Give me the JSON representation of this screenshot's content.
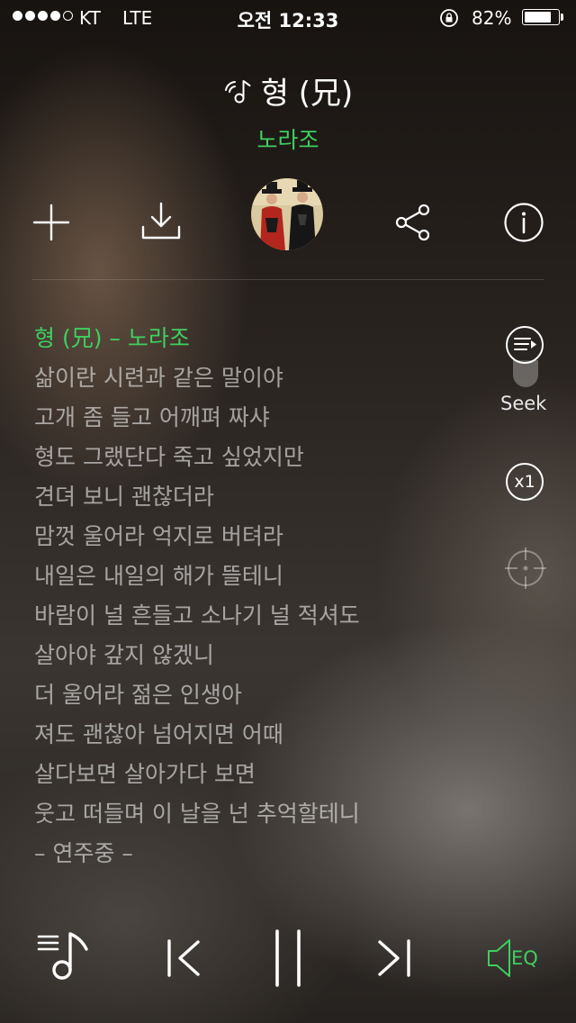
{
  "status_bar": {
    "carrier": "KT",
    "network": "LTE",
    "time": "오전 12:33",
    "battery_percent": "82%",
    "battery_level": 0.82
  },
  "song": {
    "title": "형 (兄)",
    "artist": "노라조"
  },
  "lyrics": {
    "current_line": "형 (兄) – 노라조",
    "lines": [
      "삶이란 시련과 같은 말이야",
      "고개 좀 들고 어깨펴 짜샤",
      "형도 그랬단다 죽고 싶었지만",
      "견뎌 보니 괜찮더라",
      "맘껏 울어라 억지로 버텨라",
      "내일은 내일의 해가 뜰테니",
      "바람이 널 흔들고 소나기 널 적셔도",
      "살아야 갚지 않겠니",
      "더 울어라 젊은 인생아",
      "져도 괜찮아 넘어지면 어때",
      "살다보면 살아가다 보면",
      "웃고 떠들며 이 날을 넌 추억할테니",
      "– 연주중 –"
    ]
  },
  "side_controls": {
    "seek_label": "Seek",
    "speed_label": "x1"
  },
  "bottom_bar": {
    "eq_label": "EQ"
  },
  "colors": {
    "accent": "#3ecf5f"
  }
}
